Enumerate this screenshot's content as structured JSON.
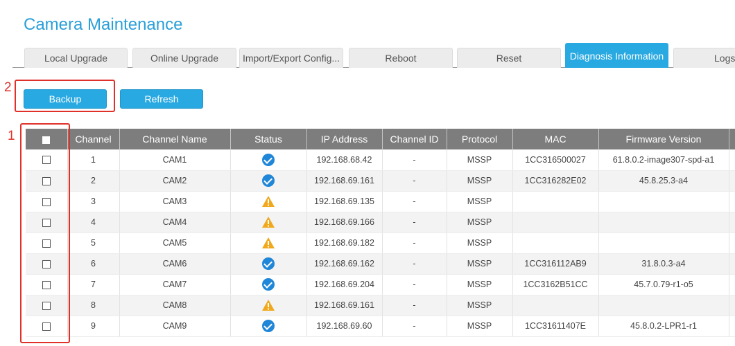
{
  "page": {
    "title": "Camera Maintenance"
  },
  "tabs": [
    {
      "label": "Local Upgrade"
    },
    {
      "label": "Online Upgrade"
    },
    {
      "label": "Import/Export Config..."
    },
    {
      "label": "Reboot"
    },
    {
      "label": "Reset"
    },
    {
      "label": "Diagnosis Information",
      "active": true
    },
    {
      "label": "Logs"
    }
  ],
  "toolbar": {
    "backup_label": "Backup",
    "refresh_label": "Refresh"
  },
  "callouts": {
    "one": "1",
    "two": "2"
  },
  "colors": {
    "accent": "#29a9e1",
    "callout": "#e0302a",
    "ok": "#1f86d8",
    "warning": "#f0a81c",
    "header_bg": "#7d7d7d"
  },
  "table": {
    "columns": [
      "Channel",
      "Channel Name",
      "Status",
      "IP Address",
      "Channel ID",
      "Protocol",
      "MAC",
      "Firmware Version"
    ],
    "rows": [
      {
        "channel": "1",
        "name": "CAM1",
        "status": "ok",
        "ip": "192.168.68.42",
        "channel_id": "-",
        "protocol": "MSSP",
        "mac": "1CC316500027",
        "firmware": "61.8.0.2-image307-spd-a1"
      },
      {
        "channel": "2",
        "name": "CAM2",
        "status": "ok",
        "ip": "192.168.69.161",
        "channel_id": "-",
        "protocol": "MSSP",
        "mac": "1CC316282E02",
        "firmware": "45.8.25.3-a4"
      },
      {
        "channel": "3",
        "name": "CAM3",
        "status": "warning",
        "ip": "192.168.69.135",
        "channel_id": "-",
        "protocol": "MSSP",
        "mac": "",
        "firmware": ""
      },
      {
        "channel": "4",
        "name": "CAM4",
        "status": "warning",
        "ip": "192.168.69.166",
        "channel_id": "-",
        "protocol": "MSSP",
        "mac": "",
        "firmware": ""
      },
      {
        "channel": "5",
        "name": "CAM5",
        "status": "warning",
        "ip": "192.168.69.182",
        "channel_id": "-",
        "protocol": "MSSP",
        "mac": "",
        "firmware": ""
      },
      {
        "channel": "6",
        "name": "CAM6",
        "status": "ok",
        "ip": "192.168.69.162",
        "channel_id": "-",
        "protocol": "MSSP",
        "mac": "1CC316112AB9",
        "firmware": "31.8.0.3-a4"
      },
      {
        "channel": "7",
        "name": "CAM7",
        "status": "ok",
        "ip": "192.168.69.204",
        "channel_id": "-",
        "protocol": "MSSP",
        "mac": "1CC3162B51CC",
        "firmware": "45.7.0.79-r1-o5"
      },
      {
        "channel": "8",
        "name": "CAM8",
        "status": "warning",
        "ip": "192.168.69.161",
        "channel_id": "-",
        "protocol": "MSSP",
        "mac": "",
        "firmware": ""
      },
      {
        "channel": "9",
        "name": "CAM9",
        "status": "ok",
        "ip": "192.168.69.60",
        "channel_id": "-",
        "protocol": "MSSP",
        "mac": "1CC31611407E",
        "firmware": "45.8.0.2-LPR1-r1"
      }
    ]
  }
}
